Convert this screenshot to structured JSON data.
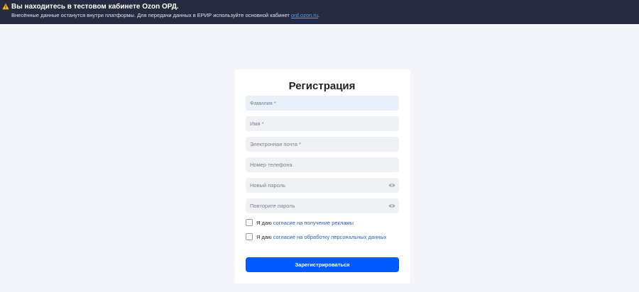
{
  "banner": {
    "title": "Вы находитесь в тестовом кабинете Ozon ОРД.",
    "text": "Внесённые данные останутся внутри платформы. Для передачи данных в ЕРИР используйте основной кабинет",
    "link": "ord.ozon.ru",
    "tail": ".",
    "icon": "warning-triangle-icon",
    "icon_color": "#f5b916"
  },
  "form": {
    "title": "Регистрация",
    "fields": {
      "last_name": {
        "placeholder": "Фамилия *",
        "value": ""
      },
      "first_name": {
        "placeholder": "Имя *",
        "value": ""
      },
      "email": {
        "placeholder": "Электронная почта *",
        "value": ""
      },
      "phone": {
        "placeholder": "Номер телефона",
        "value": ""
      },
      "password": {
        "placeholder": "Новый пароль",
        "value": "",
        "icon": "eye-icon"
      },
      "password_repeat": {
        "placeholder": "Повторите пароль",
        "value": "",
        "icon": "eye-icon"
      }
    },
    "consents": {
      "ads": {
        "lead": "Я даю",
        "link": "согласие на получение рекламы",
        "checked": false
      },
      "personal_data": {
        "lead": "Я даю",
        "link": "согласие на обработку персональных данных",
        "checked": false
      }
    },
    "submit_label": "Зарегистрироваться"
  },
  "colors": {
    "banner_bg": "#262b3f",
    "page_bg": "#f4f5fb",
    "primary": "#005bff",
    "link": "#2a5db8"
  }
}
